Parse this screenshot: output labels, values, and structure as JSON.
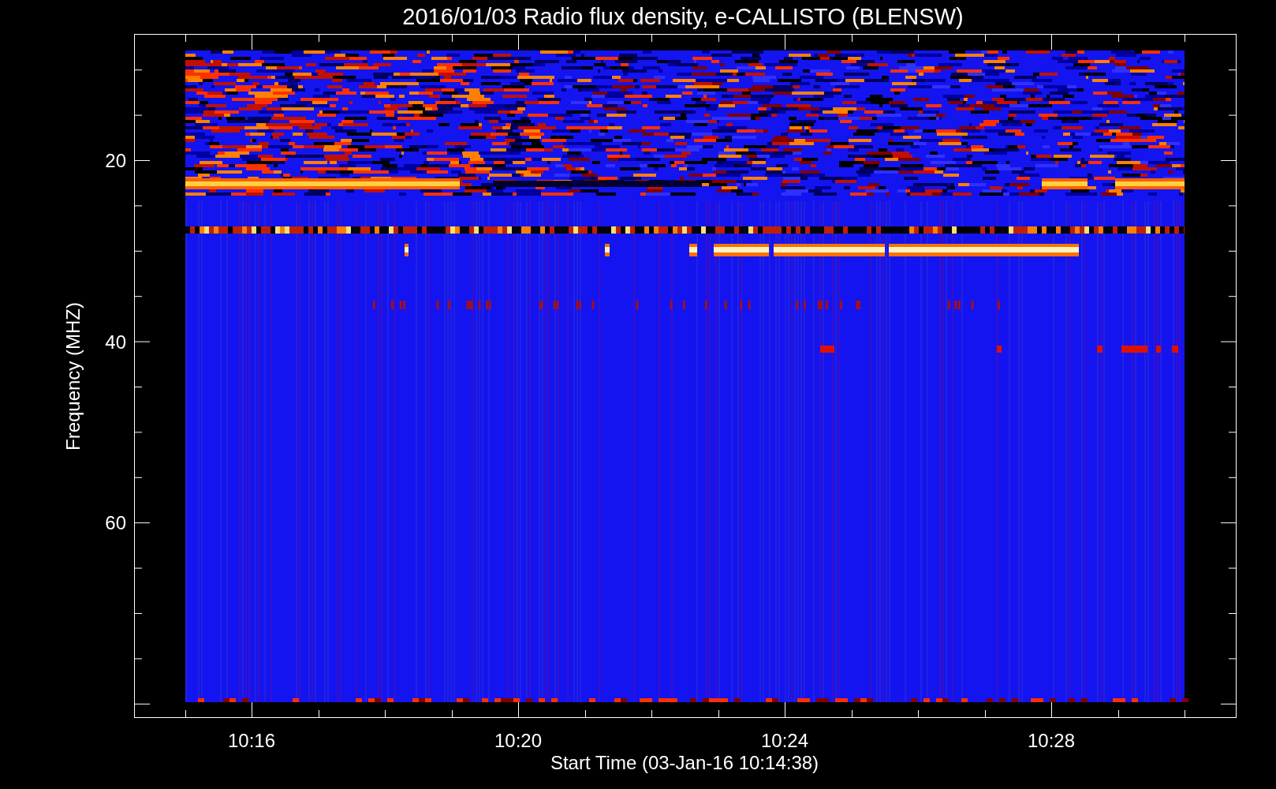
{
  "title": "2016/01/03  Radio flux density, e-CALLISTO (BLENSW)",
  "y_axis": {
    "label": "Frequency (MHZ)",
    "tick_labels": [
      "20",
      "40",
      "60"
    ]
  },
  "x_axis": {
    "label": "Start Time (03-Jan-16 10:14:38)",
    "tick_labels": [
      "10:16",
      "10:20",
      "10:24",
      "10:28"
    ]
  }
}
